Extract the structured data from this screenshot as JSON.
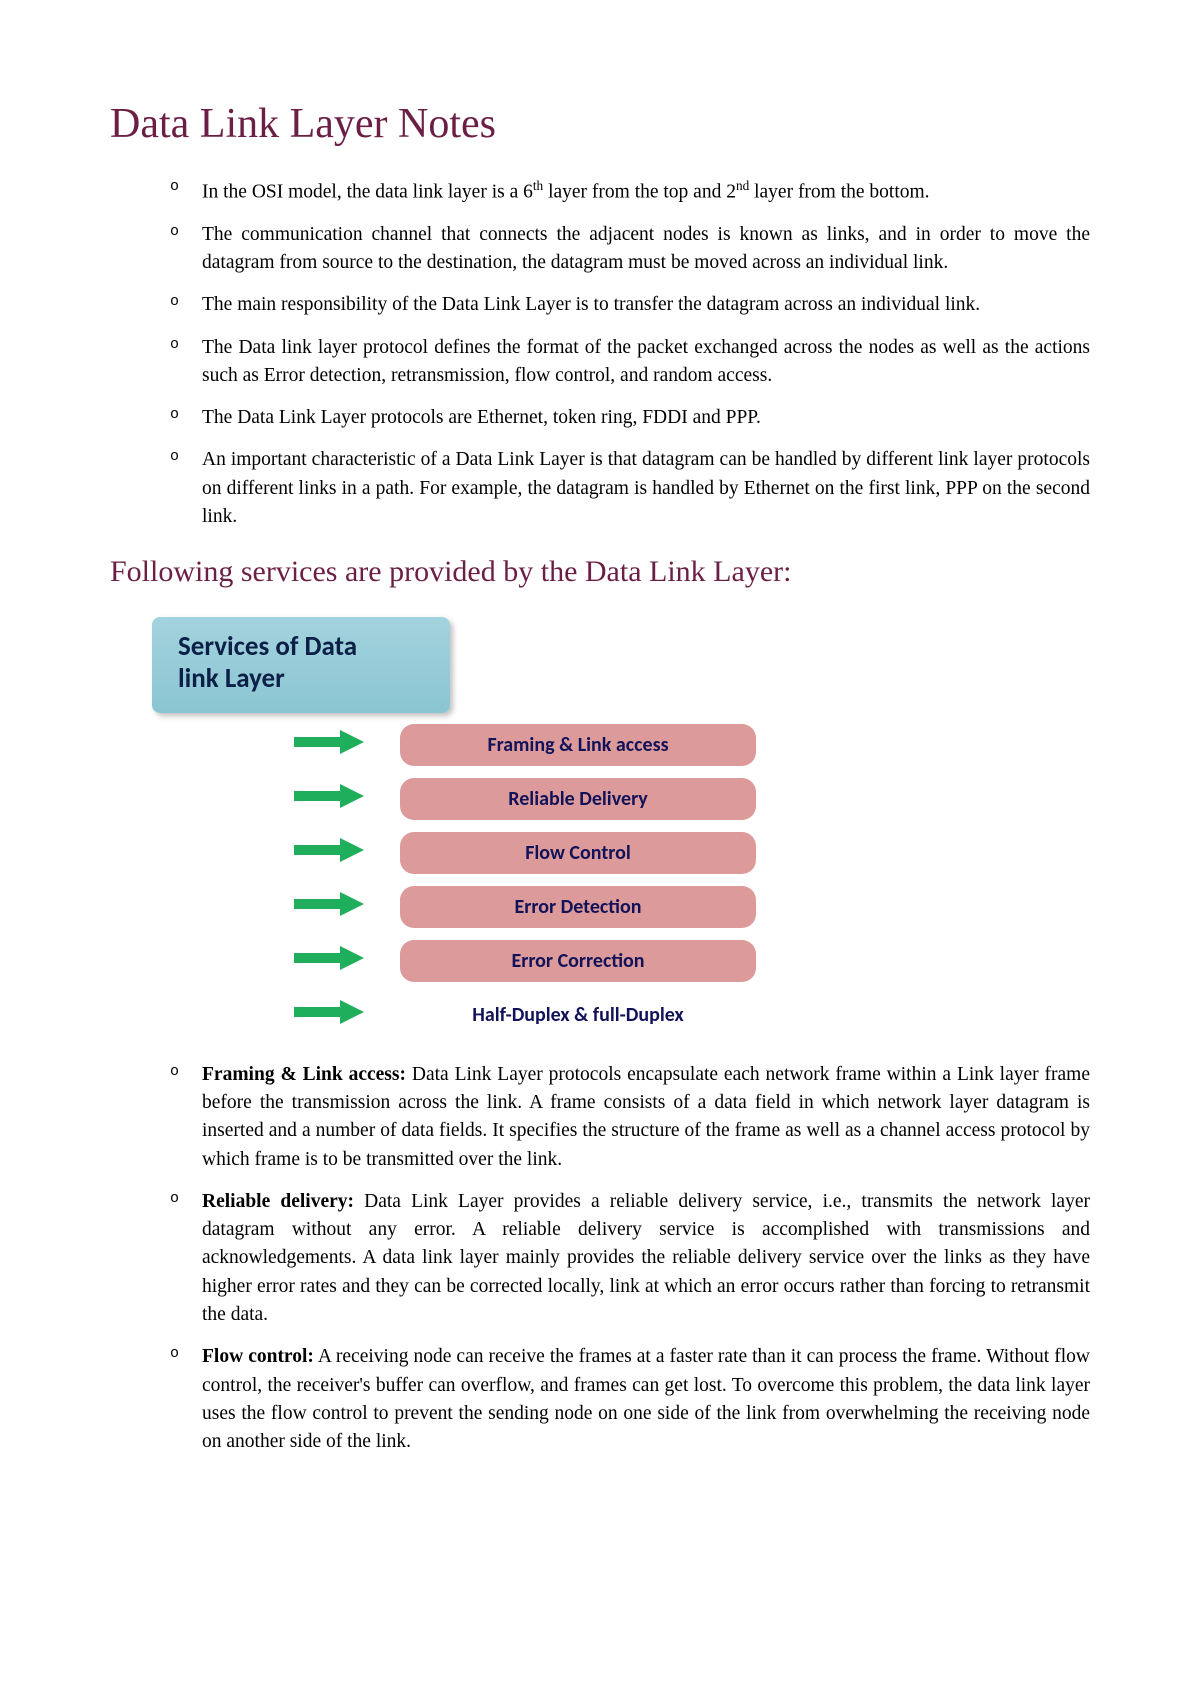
{
  "title": "Data Link Layer Notes",
  "intro": [
    {
      "pre": "In the OSI model, the data link layer is a 6",
      "sup1": "th",
      "mid": " layer from the top and 2",
      "sup2": "nd",
      "post": " layer from the bottom."
    },
    {
      "text": "The communication channel that connects the adjacent nodes is known as links, and in order to move the datagram from source to the destination, the datagram must be moved across an individual link."
    },
    {
      "text": "The main responsibility of the Data Link Layer is to transfer the datagram across an individual link."
    },
    {
      "text": "The Data link layer protocol defines the format of the packet exchanged across the nodes as well as the actions such as Error detection, retransmission, flow control, and random access."
    },
    {
      "text": "The Data Link Layer protocols are Ethernet, token ring, FDDI and PPP."
    },
    {
      "text": "An important characteristic of a Data Link Layer is that datagram can be handled by different link layer protocols on different links in a path. For example, the datagram is handled by Ethernet on the first link, PPP on the second link."
    }
  ],
  "subtitle": "Following services are provided by the Data Link Layer:",
  "diagram": {
    "header_line1": "Services of Data",
    "header_line2": "link Layer",
    "rows": [
      {
        "label": "Framing & Link access",
        "boxed": true
      },
      {
        "label": "Reliable Delivery",
        "boxed": true
      },
      {
        "label": "Flow Control",
        "boxed": true
      },
      {
        "label": "Error Detection",
        "boxed": true
      },
      {
        "label": "Error Correction",
        "boxed": true
      },
      {
        "label": "Half-Duplex & full-Duplex",
        "boxed": false
      }
    ]
  },
  "details": [
    {
      "title": "Framing & Link access:",
      "body": " Data Link Layer protocols encapsulate each network frame within a Link layer frame before the transmission across the link. A frame consists of a data field in which network layer datagram is inserted and a number of data fields. It specifies the structure of the frame as well as a channel access protocol by which frame is to be transmitted over the link."
    },
    {
      "title": "Reliable delivery:",
      "body": " Data Link Layer provides a reliable delivery service, i.e., transmits the network layer datagram without any error. A reliable delivery service is accomplished with transmissions and acknowledgements. A data link layer mainly provides the reliable delivery service over the links as they have higher error rates and they can be corrected locally, link at which an error occurs rather than forcing to retransmit the data."
    },
    {
      "title": "Flow control:",
      "body": " A receiving node can receive the frames at a faster rate than it can process the frame. Without flow control, the receiver's buffer can overflow, and frames can get lost. To overcome this problem, the data link layer uses the flow control to prevent the sending node on one side of the link from overwhelming the receiving node on another side of the link."
    }
  ]
}
